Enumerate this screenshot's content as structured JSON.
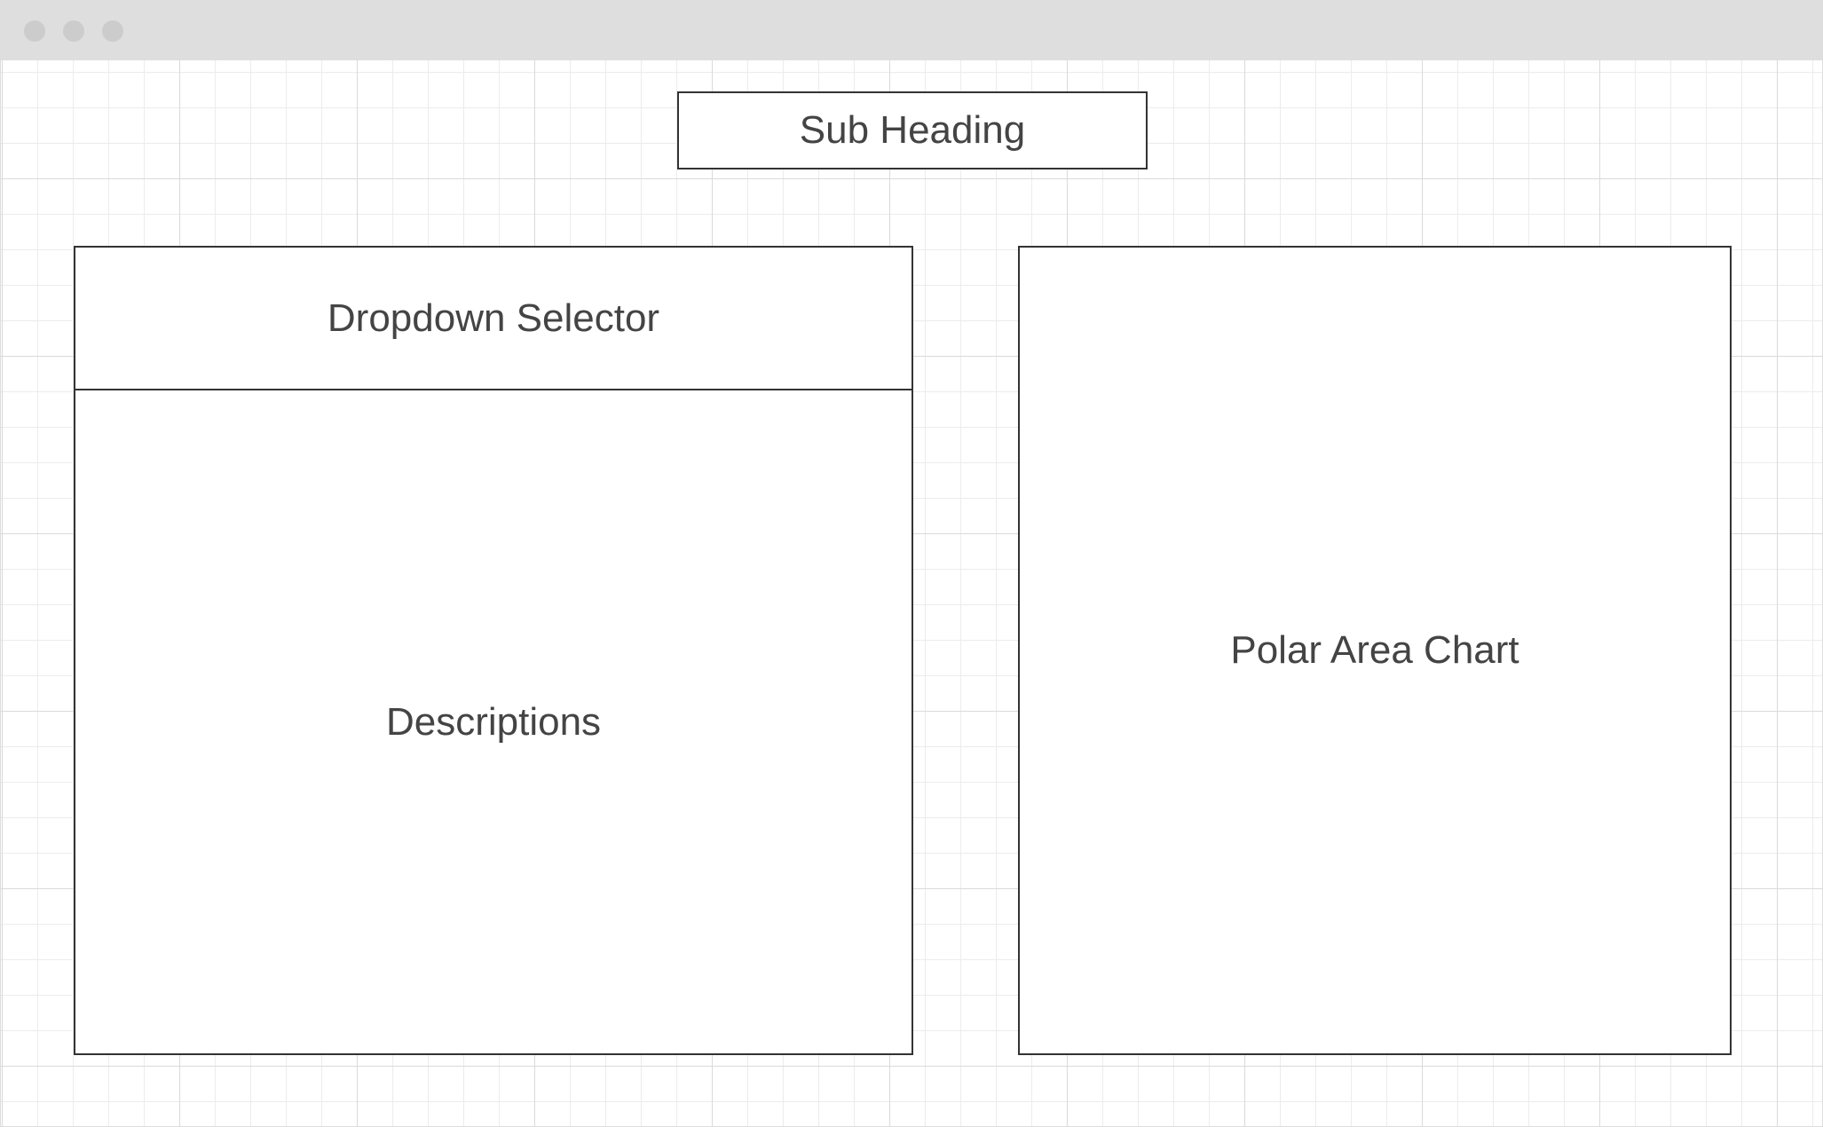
{
  "wireframe": {
    "sub_heading": "Sub Heading",
    "dropdown_selector": "Dropdown Selector",
    "descriptions": "Descriptions",
    "polar_area_chart": "Polar Area Chart"
  },
  "colors": {
    "titlebar": "#dedede",
    "window_dot": "#cccccc",
    "border": "#333333",
    "text": "#444444",
    "grid_line": "#ececec"
  }
}
